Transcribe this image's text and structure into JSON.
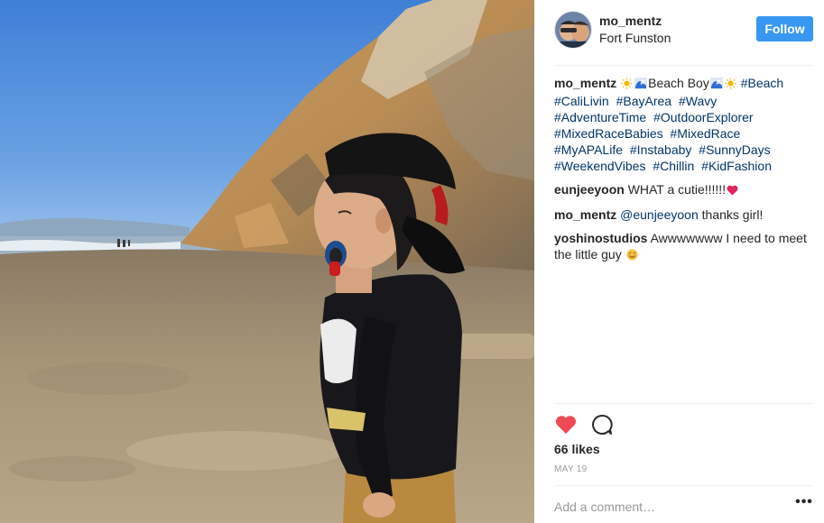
{
  "post": {
    "username": "mo_mentz",
    "location": "Fort Funston",
    "follow_label": "Follow",
    "photo_icon": "beach-photo"
  },
  "caption": {
    "username": "mo_mentz",
    "text_before": "Beach Boy",
    "emojis": [
      "sun",
      "wave",
      "wave",
      "sun"
    ],
    "hashtags": [
      "#Beach",
      "#CaliLivin",
      "#BayArea",
      "#Wavy",
      "#AdventureTime",
      "#OutdoorExplorer",
      "#MixedRaceBabies",
      "#MixedRace",
      "#MyAPALife",
      "#Instababy",
      "#SunnyDays",
      "#WeekendVibes",
      "#Chillin",
      "#KidFashion"
    ]
  },
  "comments": [
    {
      "username": "eunjeeyoon",
      "text": "WHAT a cutie!!!!!!",
      "emoji": "red-heart"
    },
    {
      "username": "mo_mentz",
      "mention": "@eunjeeyoon",
      "text": " thanks girl!"
    },
    {
      "username": "yoshinostudios",
      "text": "Awwwwwww I need to meet the little guy",
      "emoji": "smiling-face"
    }
  ],
  "actions": {
    "likes": "66 likes",
    "date": "MAY 19",
    "add_comment_placeholder": "Add a comment…",
    "more_label": "•••"
  },
  "colors": {
    "follow_button": "#3897f0",
    "hashtag": "#003569",
    "heart": "#ed4956"
  }
}
